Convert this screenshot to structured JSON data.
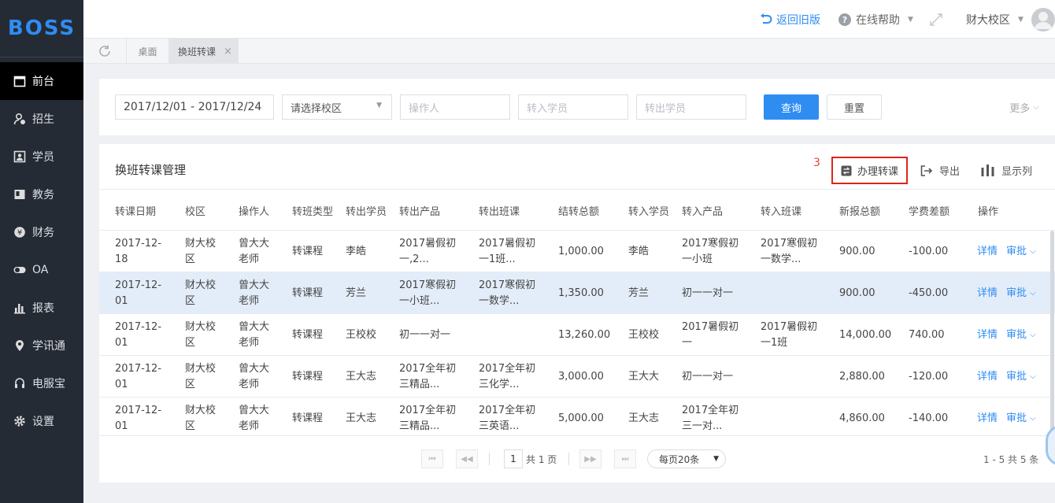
{
  "sidebar": {
    "logo": "BOSS",
    "items": [
      {
        "label": "前台",
        "icon": "calendar-icon"
      },
      {
        "label": "招生",
        "icon": "user-add-icon"
      },
      {
        "label": "学员",
        "icon": "student-card-icon"
      },
      {
        "label": "教务",
        "icon": "book-icon"
      },
      {
        "label": "财务",
        "icon": "yen-icon"
      },
      {
        "label": "OA",
        "icon": "toggle-icon"
      },
      {
        "label": "报表",
        "icon": "bar-chart-icon"
      },
      {
        "label": "学讯通",
        "icon": "location-pin-icon"
      },
      {
        "label": "电服宝",
        "icon": "headset-icon"
      },
      {
        "label": "设置",
        "icon": "gear-icon"
      }
    ]
  },
  "topbar": {
    "back_label": "返回旧版",
    "help_label": "在线帮助",
    "campus_label": "财大校区"
  },
  "tabs": {
    "home": "桌面",
    "current": "换班转课",
    "close": "×"
  },
  "filters": {
    "date_range": "2017/12/01 - 2017/12/24",
    "campus_select": "请选择校区",
    "operator_placeholder": "操作人",
    "in_student_placeholder": "转入学员",
    "out_student_placeholder": "转出学员",
    "query_button": "查询",
    "reset_button": "重置",
    "more_label": "更多"
  },
  "table_panel": {
    "title": "换班转课管理",
    "annotation_number": "3",
    "transfer_button": "办理转课",
    "export_button": "导出",
    "columns_button": "显示列"
  },
  "table": {
    "columns": [
      "转课日期",
      "校区",
      "操作人",
      "转班类型",
      "转出学员",
      "转出产品",
      "转出班课",
      "结转总额",
      "转入学员",
      "转入产品",
      "转入班课",
      "新报总额",
      "学费差额",
      "操作"
    ],
    "rows": [
      {
        "date": "2017-12-\n18",
        "campus": "财大校\n区",
        "operator": "曾大大\n老师",
        "type": "转课程",
        "out_student": "李皓",
        "out_product": "2017暑假初\n一,2...",
        "out_class": "2017暑假初\n一1班...",
        "carry_total": "1,000.00",
        "in_student": "李皓",
        "in_product": "2017寒假初\n一小班",
        "in_class": "2017寒假初\n一数学...",
        "new_total": "900.00",
        "diff": "-100.00",
        "detail": "详情",
        "approve": "审批"
      },
      {
        "date": "2017-12-\n01",
        "campus": "财大校\n区",
        "operator": "曾大大\n老师",
        "type": "转课程",
        "out_student": "芳兰",
        "out_product": "2017寒假初\n一小班...",
        "out_class": "2017寒假初\n一数学...",
        "carry_total": "1,350.00",
        "in_student": "芳兰",
        "in_product": "初一一对一",
        "in_class": "",
        "new_total": "900.00",
        "diff": "-450.00",
        "detail": "详情",
        "approve": "审批"
      },
      {
        "date": "2017-12-\n01",
        "campus": "财大校\n区",
        "operator": "曾大大\n老师",
        "type": "转课程",
        "out_student": "王校校",
        "out_product": "初一一对一",
        "out_class": "",
        "carry_total": "13,260.00",
        "in_student": "王校校",
        "in_product": "2017暑假初\n一",
        "in_class": "2017暑假初\n一1班",
        "new_total": "14,000.00",
        "diff": "740.00",
        "detail": "详情",
        "approve": "审批"
      },
      {
        "date": "2017-12-\n01",
        "campus": "财大校\n区",
        "operator": "曾大大\n老师",
        "type": "转课程",
        "out_student": "王大志",
        "out_product": "2017全年初\n三精品...",
        "out_class": "2017全年初\n三化学...",
        "carry_total": "3,000.00",
        "in_student": "王大大",
        "in_product": "初一一对一",
        "in_class": "",
        "new_total": "2,880.00",
        "diff": "-120.00",
        "detail": "详情",
        "approve": "审批"
      },
      {
        "date": "2017-12-\n01",
        "campus": "财大校\n区",
        "operator": "曾大大\n老师",
        "type": "转课程",
        "out_student": "王大志",
        "out_product": "2017全年初\n三精品...",
        "out_class": "2017全年初\n三英语...",
        "carry_total": "5,000.00",
        "in_student": "王大志",
        "in_product": "2017全年初\n三一对...",
        "in_class": "",
        "new_total": "4,860.00",
        "diff": "-140.00",
        "detail": "详情",
        "approve": "审批"
      }
    ]
  },
  "pagination": {
    "page_input": "1",
    "total_pages": "共 1 页",
    "page_size": "每页20条",
    "summary": "1 - 5   共 5 条"
  },
  "colors": {
    "accent": "#2f8df2",
    "sidebar_bg": "#252b35",
    "highlight_border": "#d9261c"
  }
}
